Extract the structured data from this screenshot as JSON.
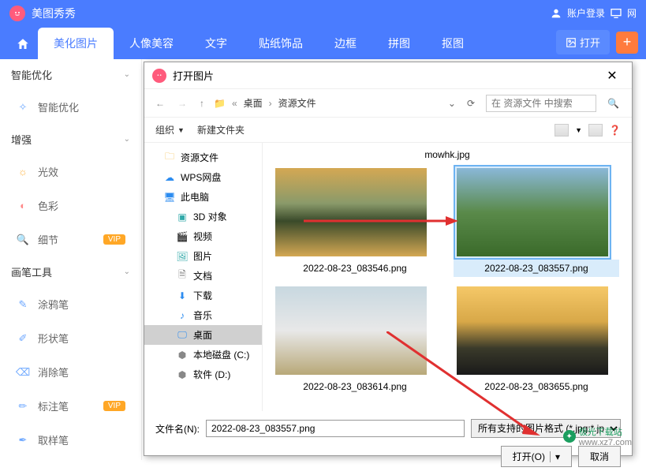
{
  "header": {
    "app_name": "美图秀秀",
    "login": "账户登录",
    "net": "网"
  },
  "nav": {
    "tabs": [
      "美化图片",
      "人像美容",
      "文字",
      "贴纸饰品",
      "边框",
      "拼图",
      "抠图"
    ],
    "open": "打开"
  },
  "sidebar": {
    "s1": "智能优化",
    "i1": "智能优化",
    "s2": "增强",
    "i2": "光效",
    "i3": "色彩",
    "i4": "细节",
    "vip": "VIP",
    "s3": "画笔工具",
    "i5": "涂鸦笔",
    "i6": "形状笔",
    "i7": "消除笔",
    "i8": "标注笔",
    "i9": "取样笔"
  },
  "dialog": {
    "title": "打开图片",
    "path": {
      "seg1": "桌面",
      "seg2": "资源文件"
    },
    "search_placeholder": "在 资源文件 中搜索",
    "toolbar": {
      "org": "组织",
      "newf": "新建文件夹"
    },
    "tree": {
      "t1": "资源文件",
      "t2": "WPS网盘",
      "t3": "此电脑",
      "t4": "3D 对象",
      "t5": "视频",
      "t6": "图片",
      "t7": "文档",
      "t8": "下载",
      "t9": "音乐",
      "t10": "桌面",
      "t11": "本地磁盘 (C:)",
      "t12": "软件 (D:)"
    },
    "mowhk": "mowhk.jpg",
    "files": {
      "f1": "2022-08-23_083546.png",
      "f2": "2022-08-23_083557.png",
      "f3": "2022-08-23_083614.png",
      "f4": "2022-08-23_083655.png"
    },
    "fname_label": "文件名(N):",
    "fname_value": "2022-08-23_083557.png",
    "filter": "所有支持的图片格式 (*.jpg;*.jp",
    "open_btn": "打开(O)",
    "cancel_btn": "取消"
  },
  "watermark": {
    "text": "极光下载站",
    "url": "www.xz7.com"
  }
}
